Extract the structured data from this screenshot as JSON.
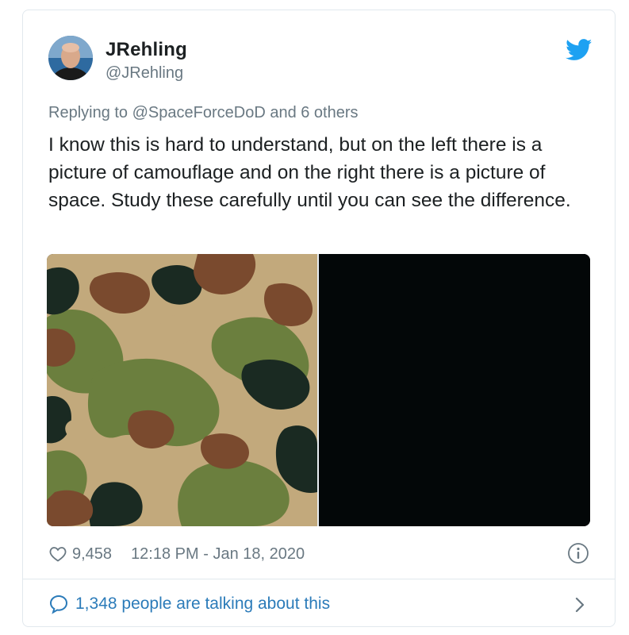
{
  "tweet": {
    "author_name": "JRehling",
    "author_handle": "@JRehling",
    "reply_context": "Replying to @SpaceForceDoD and 6 others",
    "text": "I know this is hard to understand, but on the left there is a picture of camouflage and on the right there is a picture of space. Study these carefully until you can see the difference.",
    "like_count": "9,458",
    "timestamp": "12:18 PM - Jan 18, 2020",
    "conversation_label": "1,348 people are talking about this"
  },
  "icons": {
    "brand": "twitter-bird-icon",
    "like": "heart-outline-icon",
    "info": "info-circle-icon",
    "conversation": "speech-bubble-icon",
    "more": "chevron-right-icon"
  },
  "colors": {
    "brand_blue": "#1da1f2",
    "link_blue": "#2b7bb9",
    "muted_text": "#697882",
    "camo_tan": "#c2a97c",
    "camo_green": "#6b7f3e",
    "camo_brown": "#7a4a2e",
    "camo_dark": "#1a2a22",
    "space_black": "#030708"
  }
}
